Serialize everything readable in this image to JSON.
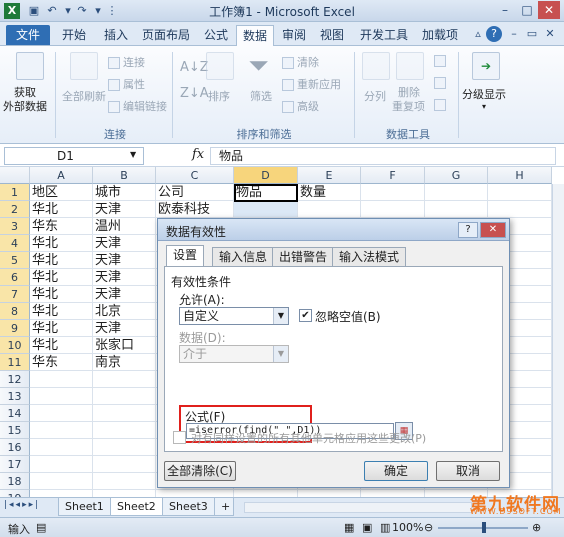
{
  "window": {
    "title": "工作簿1 - Microsoft Excel"
  },
  "quick_access": [
    "save-icon",
    "undo-icon",
    "redo-icon",
    "dropdown-icon"
  ],
  "ribbon_tabs": [
    "文件",
    "开始",
    "插入",
    "页面布局",
    "公式",
    "数据",
    "审阅",
    "视图",
    "开发工具",
    "加载项"
  ],
  "active_tab": "数据",
  "ribbon": {
    "groups": {
      "connections": "连接",
      "sort_filter": "排序和筛选",
      "data_tools": "数据工具"
    },
    "buttons": {
      "get_external_1": "获取",
      "get_external_2": "外部数据",
      "refresh_all": "全部刷新",
      "connections": "连接",
      "properties": "属性",
      "edit_links": "编辑链接",
      "sort": "排序",
      "filter": "筛选",
      "clear": "清除",
      "reapply": "重新应用",
      "advanced": "高级",
      "text_to_columns": "分列",
      "remove_dup_1": "删除",
      "remove_dup_2": "重复项",
      "outline": "分级显示"
    }
  },
  "formula_bar": {
    "name_box": "D1",
    "fx": "fx",
    "value": "物品"
  },
  "columns": [
    "A",
    "B",
    "C",
    "D",
    "E",
    "F",
    "G",
    "H"
  ],
  "rows": [
    "1",
    "2",
    "3",
    "4",
    "5",
    "6",
    "7",
    "8",
    "9",
    "10",
    "11",
    "12",
    "13",
    "14",
    "15",
    "16",
    "17",
    "18",
    "19"
  ],
  "cells": {
    "header": [
      "地区",
      "城市",
      "公司",
      "物品",
      "数量"
    ],
    "col_a": [
      "华北",
      "华东",
      "华北",
      "华北",
      "华北",
      "华北",
      "华北",
      "华北",
      "华北",
      "华东"
    ],
    "col_b": [
      "天津",
      "温州",
      "天津",
      "天津",
      "天津",
      "天津",
      "北京",
      "天津",
      "张家口",
      "南京"
    ],
    "col_c": [
      "欧泰科技"
    ]
  },
  "sheet_tabs": [
    "Sheet1",
    "Sheet2",
    "Sheet3"
  ],
  "active_sheet": "Sheet2",
  "status": {
    "mode": "输入",
    "zoom": "100%"
  },
  "dialog": {
    "title": "数据有效性",
    "tabs": [
      "设置",
      "输入信息",
      "出错警告",
      "输入法模式"
    ],
    "section": "有效性条件",
    "allow_label": "允许(A):",
    "allow_value": "自定义",
    "ignore_blank": "忽略空值(B)",
    "data_label": "数据(D):",
    "data_value": "介于",
    "formula_label": "公式(F)",
    "formula_value": "=iserror(find(\" \",D1))",
    "apply_all": "对有同样设置的所有其他单元格应用这些更改(P)",
    "clear_all": "全部清除(C)",
    "ok": "确定",
    "cancel": "取消"
  },
  "watermark": {
    "line1": "第九软件网",
    "line2": "WWW.D9SOFT.COM"
  }
}
